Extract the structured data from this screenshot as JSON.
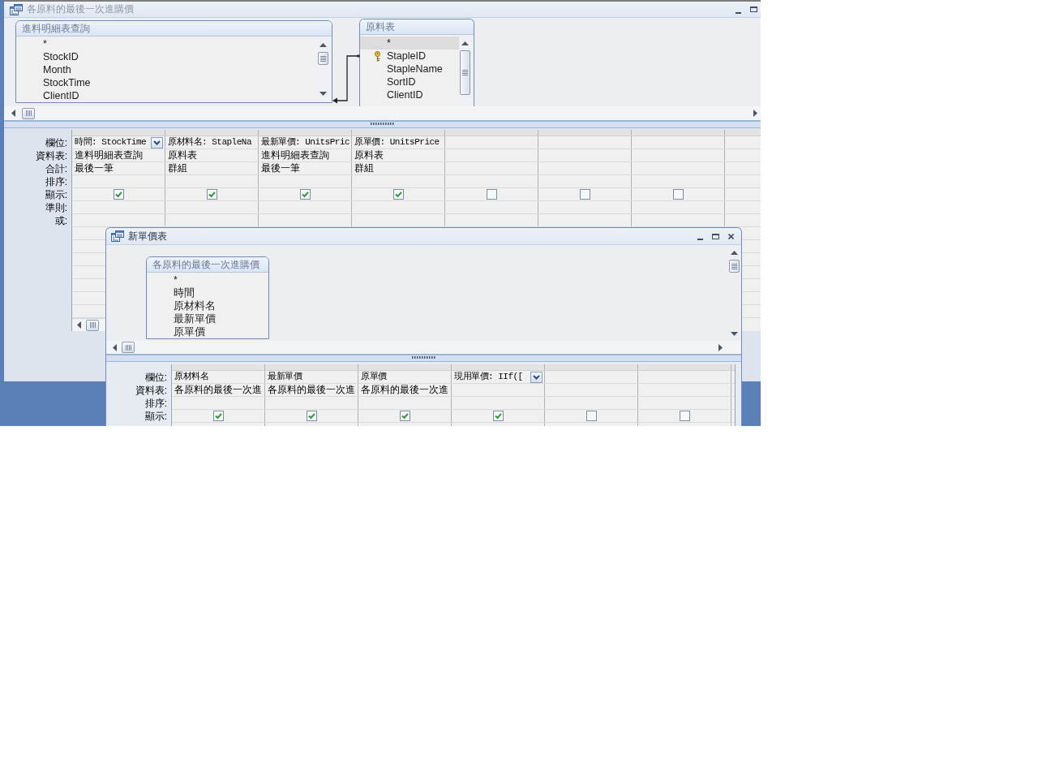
{
  "windows": [
    {
      "title": "各原料的最後一次進購價",
      "active": false,
      "controls": [
        {
          "kind": "minimize"
        },
        {
          "kind": "maximize"
        }
      ],
      "tables": [
        {
          "title": "進料明細表查詢",
          "scrollbar": true,
          "fields": [
            {
              "name": "*",
              "key": false,
              "selected": false
            },
            {
              "name": "StockID",
              "key": false,
              "selected": false
            },
            {
              "name": "Month",
              "key": false,
              "selected": false
            },
            {
              "name": "StockTime",
              "key": false,
              "selected": false
            },
            {
              "name": "ClientID",
              "key": false,
              "selected": false
            }
          ]
        },
        {
          "title": "原料表",
          "scrollbar": true,
          "fields": [
            {
              "name": "*",
              "key": false,
              "selected": true
            },
            {
              "name": "StapleID",
              "key": true,
              "selected": false
            },
            {
              "name": "StapleName",
              "key": false,
              "selected": false
            },
            {
              "name": "SortID",
              "key": false,
              "selected": false
            },
            {
              "name": "ClientID",
              "key": false,
              "selected": false
            }
          ]
        }
      ],
      "grid": {
        "rows": [
          {
            "kind": "field",
            "label": "欄位:"
          },
          {
            "kind": "table",
            "label": "資料表:"
          },
          {
            "kind": "total",
            "label": "合計:"
          },
          {
            "kind": "sort",
            "label": "排序:"
          },
          {
            "kind": "show",
            "label": "顯示:"
          },
          {
            "kind": "criteria",
            "label": "準則:"
          },
          {
            "kind": "or",
            "label": "或:"
          }
        ],
        "columns": [
          {
            "field": "時間: StockTime",
            "table": "進料明細表查詢",
            "total": "最後一筆",
            "show": true,
            "focused": true
          },
          {
            "field": "原材料名: StapleNa",
            "table": "原料表",
            "total": "群組",
            "show": true,
            "focused": false
          },
          {
            "field": "最新單價: UnitsPric",
            "table": "進料明細表查詢",
            "total": "最後一筆",
            "show": true,
            "focused": false
          },
          {
            "field": "原單價: UnitsPrice",
            "table": "原料表",
            "total": "群組",
            "show": true,
            "focused": false
          },
          {
            "show": false,
            "focused": false
          },
          {
            "show": false,
            "focused": false
          },
          {
            "show": false,
            "focused": false
          }
        ]
      }
    },
    {
      "title": "新單價表",
      "active": true,
      "controls": [
        {
          "kind": "minimize"
        },
        {
          "kind": "maximize"
        },
        {
          "kind": "close"
        }
      ],
      "tables": [
        {
          "title": "各原料的最後一次進購價",
          "scrollbar": false,
          "fields": [
            {
              "name": "*",
              "key": false,
              "selected": false
            },
            {
              "name": "時間",
              "key": false,
              "selected": false
            },
            {
              "name": "原材料名",
              "key": false,
              "selected": false
            },
            {
              "name": "最新單價",
              "key": false,
              "selected": false
            },
            {
              "name": "原單價",
              "key": false,
              "selected": false
            }
          ]
        }
      ],
      "grid": {
        "rows": [
          {
            "kind": "field",
            "label": "欄位:"
          },
          {
            "kind": "table",
            "label": "資料表:"
          },
          {
            "kind": "sort",
            "label": "排序:"
          },
          {
            "kind": "show",
            "label": "顯示:"
          }
        ],
        "columns": [
          {
            "field": "原材料名",
            "table": "各原料的最後一次進",
            "show": true,
            "focused": false
          },
          {
            "field": "最新單價",
            "table": "各原料的最後一次進",
            "show": true,
            "focused": false
          },
          {
            "field": "原單價",
            "table": "各原料的最後一次進",
            "show": true,
            "focused": false
          },
          {
            "field": "現用單價: IIf([",
            "show": true,
            "focused": true
          },
          {
            "show": false,
            "focused": false
          },
          {
            "show": false,
            "focused": false
          }
        ]
      }
    }
  ]
}
